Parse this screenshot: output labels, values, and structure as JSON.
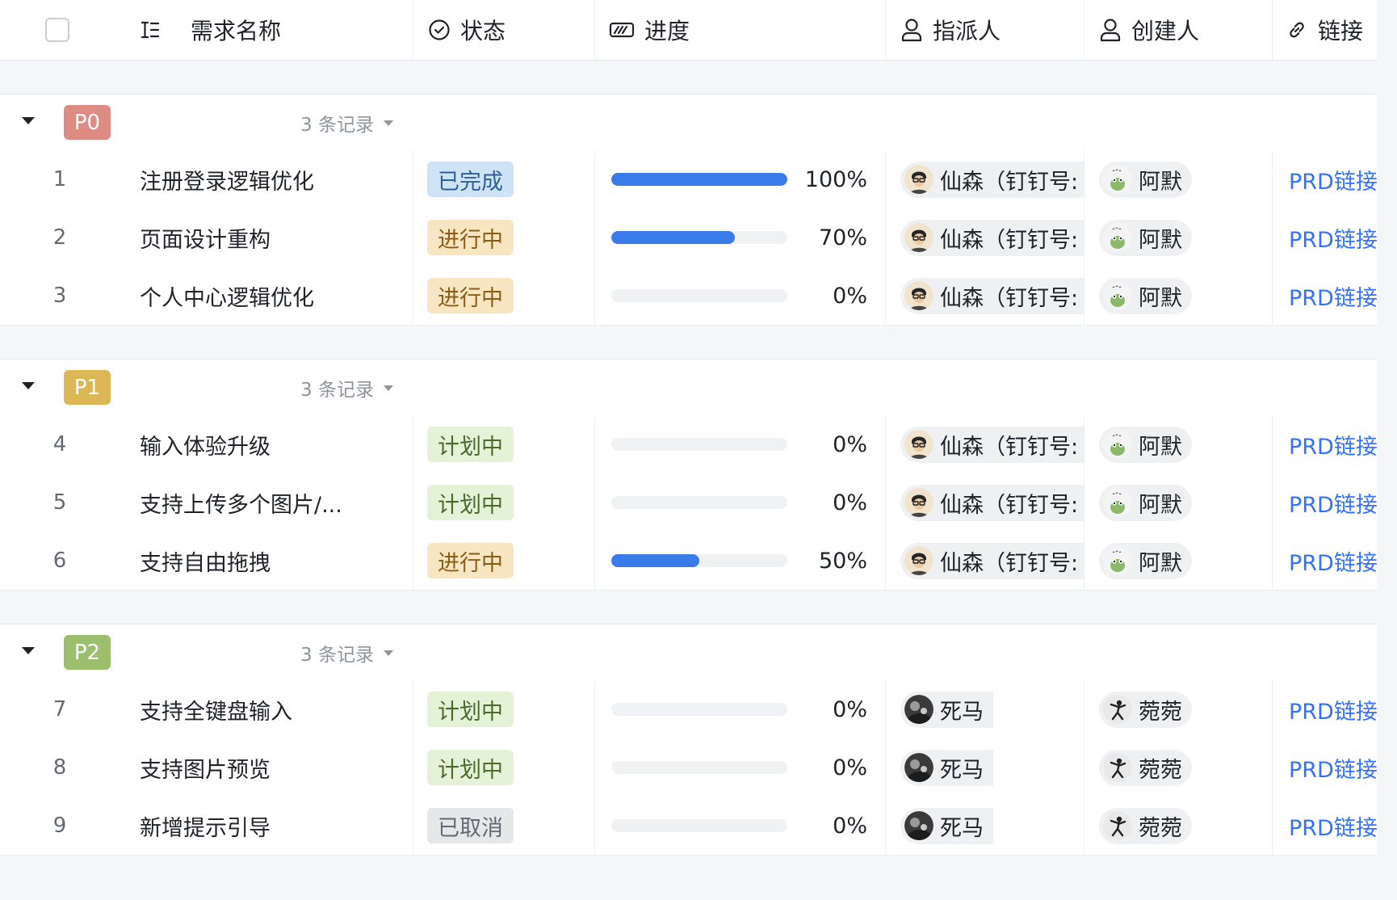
{
  "header": {
    "columns": [
      {
        "label": "需求名称",
        "icon": "text-field-icon"
      },
      {
        "label": "状态",
        "icon": "status-circle-icon"
      },
      {
        "label": "进度",
        "icon": "progress-icon"
      },
      {
        "label": "指派人",
        "icon": "person-icon"
      },
      {
        "label": "创建人",
        "icon": "person-icon"
      },
      {
        "label": "链接",
        "icon": "link-icon"
      }
    ]
  },
  "colors": {
    "P0": "#de8b83",
    "P1": "#dcb755",
    "P2": "#9bbf6d",
    "progress": "#3a7bea",
    "link": "#3370ff"
  },
  "status_styles": {
    "已完成": {
      "bg": "#cfe3f6",
      "fg": "#2f5f99"
    },
    "进行中": {
      "bg": "#f8e6c2",
      "fg": "#8c5b15"
    },
    "计划中": {
      "bg": "#e4f2d7",
      "fg": "#4b6b2a"
    },
    "已取消": {
      "bg": "#e6e7e9",
      "fg": "#646a73"
    }
  },
  "groups": [
    {
      "label": "P0",
      "count": "3 条记录",
      "records": [
        {
          "index": "1",
          "name": "注册登录逻辑优化",
          "status": "已完成",
          "progress": 1.0,
          "progress_text": "100%",
          "assignee": "仙森（钉钉号:",
          "assignee_avatar": "person-glasses",
          "creator": "阿默",
          "creator_avatar": "frog",
          "link": "PRD链接"
        },
        {
          "index": "2",
          "name": "页面设计重构",
          "status": "进行中",
          "progress": 0.7,
          "progress_text": "70%",
          "assignee": "仙森（钉钉号:",
          "assignee_avatar": "person-glasses",
          "creator": "阿默",
          "creator_avatar": "frog",
          "link": "PRD链接"
        },
        {
          "index": "3",
          "name": "个人中心逻辑优化",
          "status": "进行中",
          "progress": 0.0,
          "progress_text": "0%",
          "assignee": "仙森（钉钉号:",
          "assignee_avatar": "person-glasses",
          "creator": "阿默",
          "creator_avatar": "frog",
          "link": "PRD链接"
        }
      ]
    },
    {
      "label": "P1",
      "count": "3 条记录",
      "records": [
        {
          "index": "4",
          "name": "输入体验升级",
          "status": "计划中",
          "progress": 0.0,
          "progress_text": "0%",
          "assignee": "仙森（钉钉号:",
          "assignee_avatar": "person-glasses",
          "creator": "阿默",
          "creator_avatar": "frog",
          "link": "PRD链接"
        },
        {
          "index": "5",
          "name": "支持上传多个图片/...",
          "status": "计划中",
          "progress": 0.0,
          "progress_text": "0%",
          "assignee": "仙森（钉钉号:",
          "assignee_avatar": "person-glasses",
          "creator": "阿默",
          "creator_avatar": "frog",
          "link": "PRD链接"
        },
        {
          "index": "6",
          "name": "支持自由拖拽",
          "status": "进行中",
          "progress": 0.5,
          "progress_text": "50%",
          "assignee": "仙森（钉钉号:",
          "assignee_avatar": "person-glasses",
          "creator": "阿默",
          "creator_avatar": "frog",
          "link": "PRD链接"
        }
      ]
    },
    {
      "label": "P2",
      "count": "3 条记录",
      "records": [
        {
          "index": "7",
          "name": "支持全键盘输入",
          "status": "计划中",
          "progress": 0.0,
          "progress_text": "0%",
          "assignee": "死马",
          "assignee_avatar": "dark-photo",
          "creator": "菀菀",
          "creator_avatar": "dancer",
          "link": "PRD链接"
        },
        {
          "index": "8",
          "name": "支持图片预览",
          "status": "计划中",
          "progress": 0.0,
          "progress_text": "0%",
          "assignee": "死马",
          "assignee_avatar": "dark-photo",
          "creator": "菀菀",
          "creator_avatar": "dancer",
          "link": "PRD链接"
        },
        {
          "index": "9",
          "name": "新增提示引导",
          "status": "已取消",
          "progress": 0.0,
          "progress_text": "0%",
          "assignee": "死马",
          "assignee_avatar": "dark-photo",
          "creator": "菀菀",
          "creator_avatar": "dancer",
          "link": "PRD链接"
        }
      ]
    }
  ]
}
